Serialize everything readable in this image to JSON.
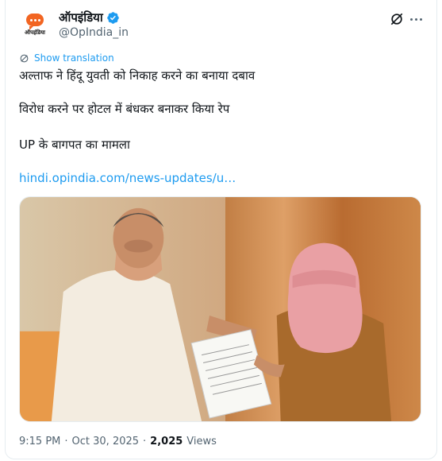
{
  "account": {
    "display_name": "ऑपइंडिया",
    "handle": "@OpIndia_in",
    "avatar_brand": "ऑपइंडिया",
    "verified_color": "#1d9bf0"
  },
  "translate": {
    "label": "Show translation"
  },
  "tweet": {
    "line1": "अल्ताफ ने हिंदू युवती को निकाह करने का बनाया दबाव",
    "line2": "विरोध करने पर होटल में बंधकर बनाकर किया रेप",
    "line3": "UP के बागपत का मामला",
    "link": "hindi.opindia.com/news-updates/u…"
  },
  "meta": {
    "time": "9:15 PM",
    "separator1": "·",
    "date": "Oct 30, 2025",
    "separator2": "·",
    "views_count": "2,025",
    "views_label": "Views"
  },
  "icons": {
    "grok": "grok-icon",
    "more": "more-options-icon",
    "translate": "translate-icon"
  },
  "colors": {
    "accent": "#1d9bf0",
    "brand": "#f26522",
    "text": "#0f1419",
    "muted": "#536471"
  }
}
